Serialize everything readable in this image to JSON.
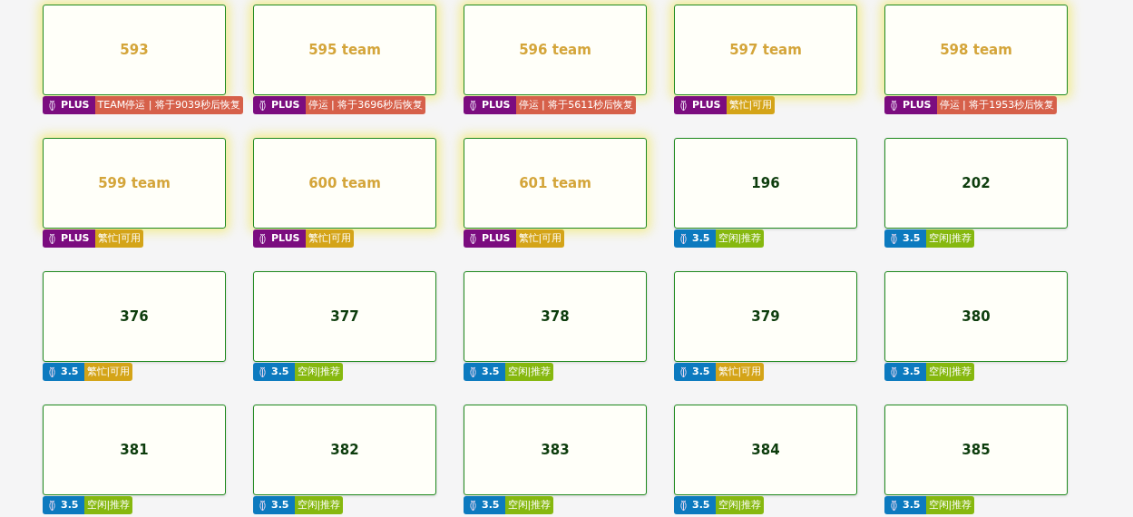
{
  "cards": [
    {
      "title": "593",
      "kind": "plus",
      "tier": "PLUS",
      "status": {
        "kind": "stopped",
        "text": "TEAM停运 | 将于9039秒后恢复"
      }
    },
    {
      "title": "595 team",
      "kind": "plus",
      "tier": "PLUS",
      "status": {
        "kind": "stopped",
        "text": "停运 | 将于3696秒后恢复"
      }
    },
    {
      "title": "596 team",
      "kind": "plus",
      "tier": "PLUS",
      "status": {
        "kind": "stopped",
        "text": "停运 | 将于5611秒后恢复"
      }
    },
    {
      "title": "597 team",
      "kind": "plus",
      "tier": "PLUS",
      "status": {
        "kind": "busy",
        "text": "繁忙|可用"
      }
    },
    {
      "title": "598 team",
      "kind": "plus",
      "tier": "PLUS",
      "status": {
        "kind": "stopped",
        "text": "停运 | 将于1953秒后恢复"
      }
    },
    {
      "title": "599 team",
      "kind": "plus",
      "tier": "PLUS",
      "status": {
        "kind": "busy",
        "text": "繁忙|可用"
      }
    },
    {
      "title": "600 team",
      "kind": "plus",
      "tier": "PLUS",
      "status": {
        "kind": "busy",
        "text": "繁忙|可用"
      }
    },
    {
      "title": "601 team",
      "kind": "plus",
      "tier": "PLUS",
      "status": {
        "kind": "busy",
        "text": "繁忙|可用"
      }
    },
    {
      "title": "196",
      "kind": "standard",
      "tier": "3.5",
      "status": {
        "kind": "idle",
        "text": "空闲|推荐"
      }
    },
    {
      "title": "202",
      "kind": "standard",
      "tier": "3.5",
      "status": {
        "kind": "idle",
        "text": "空闲|推荐"
      }
    },
    {
      "title": "376",
      "kind": "standard",
      "tier": "3.5",
      "status": {
        "kind": "busy",
        "text": "繁忙|可用"
      }
    },
    {
      "title": "377",
      "kind": "standard",
      "tier": "3.5",
      "status": {
        "kind": "idle",
        "text": "空闲|推荐"
      }
    },
    {
      "title": "378",
      "kind": "standard",
      "tier": "3.5",
      "status": {
        "kind": "idle",
        "text": "空闲|推荐"
      }
    },
    {
      "title": "379",
      "kind": "standard",
      "tier": "3.5",
      "status": {
        "kind": "busy",
        "text": "繁忙|可用"
      }
    },
    {
      "title": "380",
      "kind": "standard",
      "tier": "3.5",
      "status": {
        "kind": "idle",
        "text": "空闲|推荐"
      }
    },
    {
      "title": "381",
      "kind": "standard",
      "tier": "3.5",
      "status": {
        "kind": "idle",
        "text": "空闲|推荐"
      }
    },
    {
      "title": "382",
      "kind": "standard",
      "tier": "3.5",
      "status": {
        "kind": "idle",
        "text": "空闲|推荐"
      }
    },
    {
      "title": "383",
      "kind": "standard",
      "tier": "3.5",
      "status": {
        "kind": "idle",
        "text": "空闲|推荐"
      }
    },
    {
      "title": "384",
      "kind": "standard",
      "tier": "3.5",
      "status": {
        "kind": "idle",
        "text": "空闲|推荐"
      }
    },
    {
      "title": "385",
      "kind": "standard",
      "tier": "3.5",
      "status": {
        "kind": "idle",
        "text": "空闲|推荐"
      }
    }
  ]
}
